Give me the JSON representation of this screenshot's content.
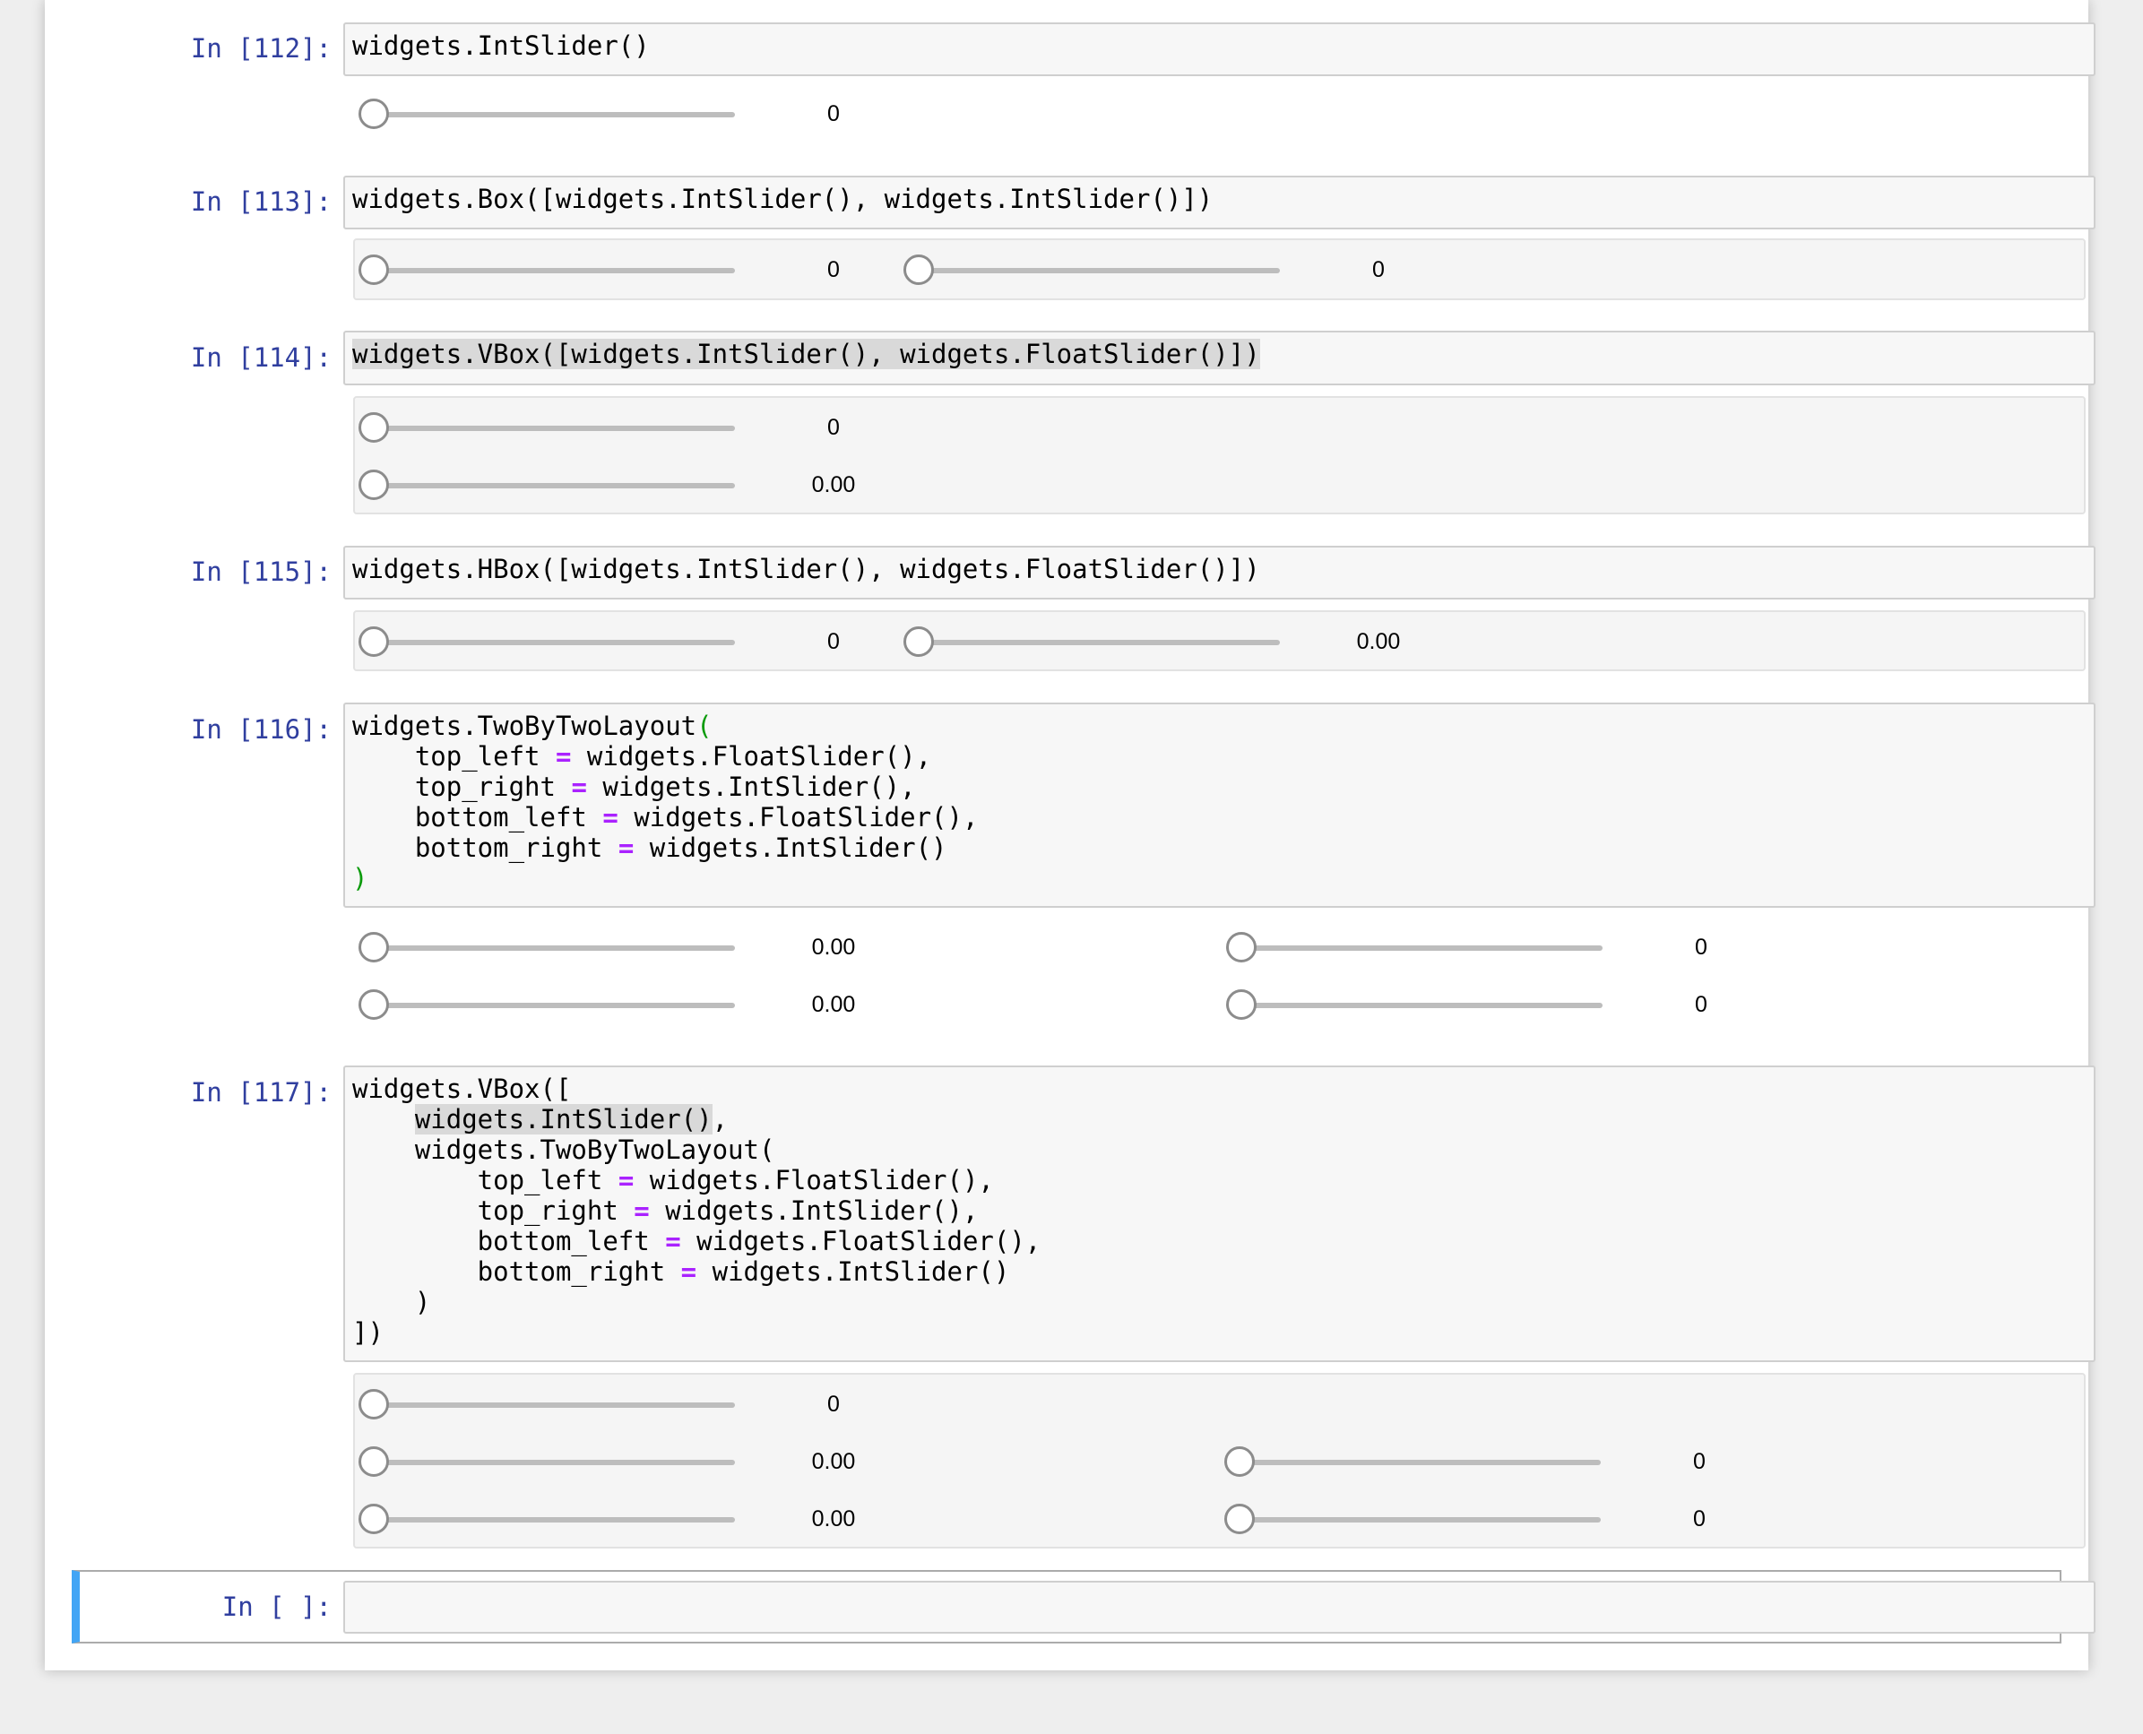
{
  "cells": [
    {
      "prompt": "In [112]:",
      "code": [
        "widgets.IntSlider()"
      ],
      "output_sliders": [
        {
          "value": 0,
          "readout": "0"
        }
      ]
    },
    {
      "prompt": "In [113]:",
      "code": [
        "widgets.Box([widgets.IntSlider(), widgets.IntSlider()])"
      ],
      "output_sliders": [
        {
          "value": 0,
          "readout": "0"
        },
        {
          "value": 0,
          "readout": "0"
        }
      ]
    },
    {
      "prompt": "In [114]:",
      "code": [
        "widgets.VBox([widgets.IntSlider(), widgets.FloatSlider()])"
      ],
      "output_sliders": [
        {
          "value": 0,
          "readout": "0"
        },
        {
          "value": 0,
          "readout": "0.00"
        }
      ]
    },
    {
      "prompt": "In [115]:",
      "code": [
        "widgets.HBox([widgets.IntSlider(), widgets.FloatSlider()])"
      ],
      "output_sliders": [
        {
          "value": 0,
          "readout": "0"
        },
        {
          "value": 0,
          "readout": "0.00"
        }
      ]
    },
    {
      "prompt": "In [116]:",
      "code": [
        "widgets.TwoByTwoLayout(",
        "    top_left = widgets.FloatSlider(),",
        "    top_right = widgets.IntSlider(),",
        "    bottom_left = widgets.FloatSlider(),",
        "    bottom_right = widgets.IntSlider()",
        ")"
      ],
      "output_sliders": [
        {
          "value": 0,
          "readout": "0.00"
        },
        {
          "value": 0,
          "readout": "0"
        },
        {
          "value": 0,
          "readout": "0.00"
        },
        {
          "value": 0,
          "readout": "0"
        }
      ]
    },
    {
      "prompt": "In [117]:",
      "code": [
        "widgets.VBox([",
        "    widgets.IntSlider(),",
        "    widgets.TwoByTwoLayout(",
        "        top_left = widgets.FloatSlider(),",
        "        top_right = widgets.IntSlider(),",
        "        bottom_left = widgets.FloatSlider(),",
        "        bottom_right = widgets.IntSlider()",
        "    )",
        "])"
      ],
      "output_sliders": [
        {
          "value": 0,
          "readout": "0"
        },
        {
          "value": 0,
          "readout": "0.00"
        },
        {
          "value": 0,
          "readout": "0"
        },
        {
          "value": 0,
          "readout": "0.00"
        },
        {
          "value": 0,
          "readout": "0"
        }
      ]
    },
    {
      "prompt": "In [ ]:",
      "code": [
        ""
      ],
      "output_sliders": []
    }
  ],
  "colors": {
    "prompt": "#303f9f",
    "operator": "#aa22ff",
    "bracket": "#0b9b0b",
    "active_cell_bar": "#42a5f5"
  }
}
